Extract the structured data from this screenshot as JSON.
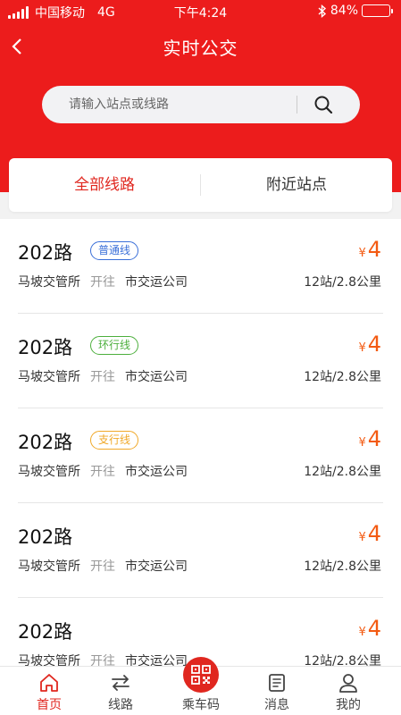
{
  "status_bar": {
    "carrier": "中国移动",
    "network": "4G",
    "time": "下午4:24",
    "battery_text": "84%",
    "battery_level": 0.84
  },
  "nav": {
    "title": "实时公交"
  },
  "search": {
    "placeholder": "请输入站点或线路"
  },
  "tabs": [
    {
      "label": "全部线路",
      "active": true
    },
    {
      "label": "附近站点",
      "active": false
    }
  ],
  "routes": [
    {
      "name": "202路",
      "badge": "普通线",
      "badge_color": "#3a6fd8",
      "price_symbol": "¥",
      "price": "4",
      "from": "马坡交管所",
      "via": "开往",
      "to": "市交运公司",
      "info": "12站/2.8公里"
    },
    {
      "name": "202路",
      "badge": "环行线",
      "badge_color": "#4caf3c",
      "price_symbol": "¥",
      "price": "4",
      "from": "马坡交管所",
      "via": "开往",
      "to": "市交运公司",
      "info": "12站/2.8公里"
    },
    {
      "name": "202路",
      "badge": "支行线",
      "badge_color": "#f0a828",
      "price_symbol": "¥",
      "price": "4",
      "from": "马坡交管所",
      "via": "开往",
      "to": "市交运公司",
      "info": "12站/2.8公里"
    },
    {
      "name": "202路",
      "badge": "",
      "badge_color": "",
      "price_symbol": "¥",
      "price": "4",
      "from": "马坡交管所",
      "via": "开往",
      "to": "市交运公司",
      "info": "12站/2.8公里"
    },
    {
      "name": "202路",
      "badge": "",
      "badge_color": "",
      "price_symbol": "¥",
      "price": "4",
      "from": "马坡交管所",
      "via": "开往",
      "to": "市交运公司",
      "info": "12站/2.8公里"
    }
  ],
  "tabbar": [
    {
      "label": "首页",
      "icon": "home-icon",
      "active": true
    },
    {
      "label": "线路",
      "icon": "route-switch-icon",
      "active": false
    },
    {
      "label": "乘车码",
      "icon": "qr-code-icon",
      "active": false
    },
    {
      "label": "消息",
      "icon": "message-icon",
      "active": false
    },
    {
      "label": "我的",
      "icon": "profile-icon",
      "active": false
    }
  ],
  "colors": {
    "brand_red": "#ec1c1c",
    "accent_red": "#e0271f",
    "price_orange": "#f35a12"
  }
}
